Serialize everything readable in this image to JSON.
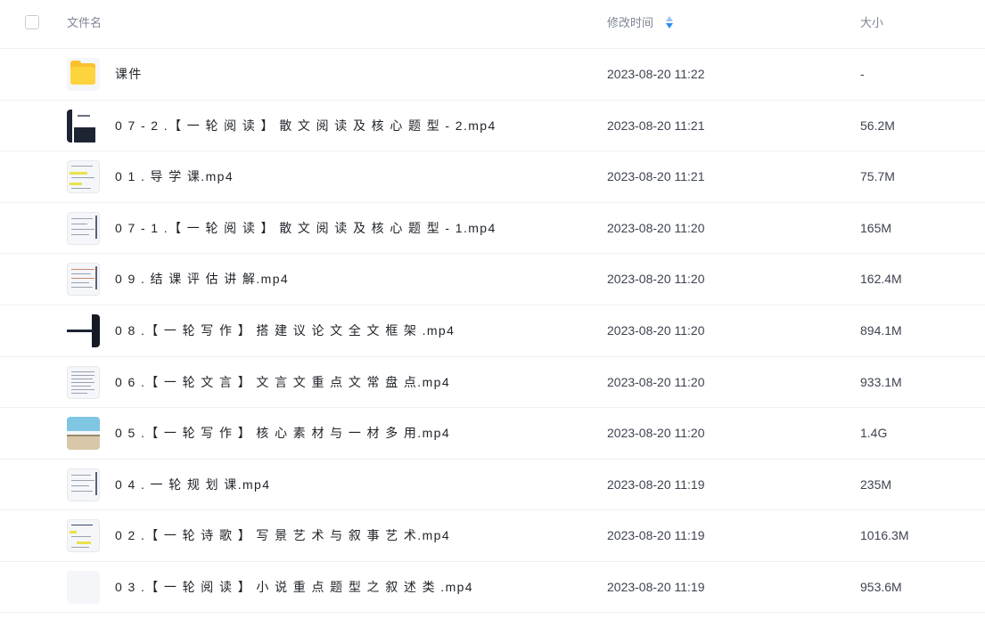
{
  "header": {
    "name_label": "文件名",
    "time_label": "修改时间",
    "size_label": "大小"
  },
  "files": [
    {
      "name": "课件",
      "time": "2023-08-20 11:22",
      "size": "-",
      "thumb": "folder-icon"
    },
    {
      "name": "0 7 - 2 .【 一 轮 阅 读 】 散 文 阅 读 及 核 心 题 型 - 2.mp4",
      "time": "2023-08-20 11:21",
      "size": "56.2M",
      "thumb": "video-thumbnail"
    },
    {
      "name": "0 1 . 导 学 课.mp4",
      "time": "2023-08-20 11:21",
      "size": "75.7M",
      "thumb": "video-thumbnail"
    },
    {
      "name": "0 7 - 1 .【 一 轮 阅 读 】 散 文 阅 读 及 核 心 题 型 - 1.mp4",
      "time": "2023-08-20 11:20",
      "size": "165M",
      "thumb": "video-thumbnail"
    },
    {
      "name": "0 9 . 结 课 评 估 讲 解.mp4",
      "time": "2023-08-20 11:20",
      "size": "162.4M",
      "thumb": "video-thumbnail"
    },
    {
      "name": "0 8 .【 一 轮 写 作 】 搭 建 议 论 文 全 文 框 架 .mp4",
      "time": "2023-08-20 11:20",
      "size": "894.1M",
      "thumb": "video-thumbnail"
    },
    {
      "name": "0 6 .【 一 轮 文 言 】 文 言 文 重 点 文 常 盘 点.mp4",
      "time": "2023-08-20 11:20",
      "size": "933.1M",
      "thumb": "video-thumbnail"
    },
    {
      "name": "0 5 .【 一 轮 写 作 】 核 心 素 材 与 一 材 多 用.mp4",
      "time": "2023-08-20 11:20",
      "size": "1.4G",
      "thumb": "video-thumbnail"
    },
    {
      "name": "0 4 . 一 轮 规 划 课.mp4",
      "time": "2023-08-20 11:19",
      "size": "235M",
      "thumb": "video-thumbnail"
    },
    {
      "name": "0 2 .【 一 轮 诗 歌 】 写 景 艺 术 与 叙 事 艺 术.mp4",
      "time": "2023-08-20 11:19",
      "size": "1016.3M",
      "thumb": "video-thumbnail"
    },
    {
      "name": "0 3 .【 一 轮 阅 读 】 小 说 重 点 题 型 之 叙 述 类 .mp4",
      "time": "2023-08-20 11:19",
      "size": "953.6M",
      "thumb": "video-thumbnail"
    }
  ],
  "colors": {
    "folder": "#fdd43e",
    "sort_active": "#2b8cf0",
    "header_text": "#7d8594"
  }
}
